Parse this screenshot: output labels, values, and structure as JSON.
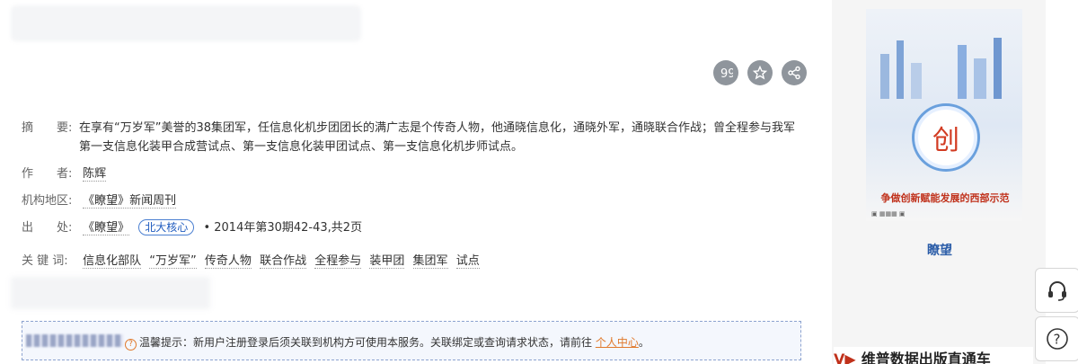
{
  "abstract": {
    "label": "摘　　要:",
    "text": "在享有“万岁军”美誉的38集团军，任信息化机步团团长的满广志是个传奇人物，他通晓信息化，通晓外军，通晓联合作战；曾全程参与我军第一支信息化装甲合成营试点、第一支信息化装甲团试点、第一支信息化机步师试点。"
  },
  "author": {
    "label": "作　　者:",
    "name": "陈辉"
  },
  "institution": {
    "label": "机构地区:",
    "value": "《瞭望》新闻周刊"
  },
  "source": {
    "label": "出　　处:",
    "journal": "《瞭望》",
    "badge": "北大核心",
    "separator": "•",
    "issue": "2014年第30期42-43,共2页"
  },
  "keywords": {
    "label": "关 键 词:",
    "items": [
      "信息化部队",
      "“万岁军”",
      "传奇人物",
      "联合作战",
      "全程参与",
      "装甲团",
      "集团军",
      "试点"
    ]
  },
  "notice": {
    "text": "温馨提示：新用户注册登录后须关联到机构方可使用本服务。关联绑定或查询请求状态，请前往",
    "link": "个人中心",
    "end": "。"
  },
  "sidebar": {
    "cover_char": "创",
    "cover_slogan": "争做创新赋能发展的西部示范",
    "journal_logo": "瞭望",
    "banner_text": "维普数据出版直通车"
  },
  "colors": {
    "accent": "#1f5bbf",
    "link_orange": "#e0792b",
    "action_gray": "#8f959c"
  },
  "icons": [
    "quote-icon",
    "star-icon",
    "share-icon",
    "headset-icon",
    "help-icon"
  ]
}
